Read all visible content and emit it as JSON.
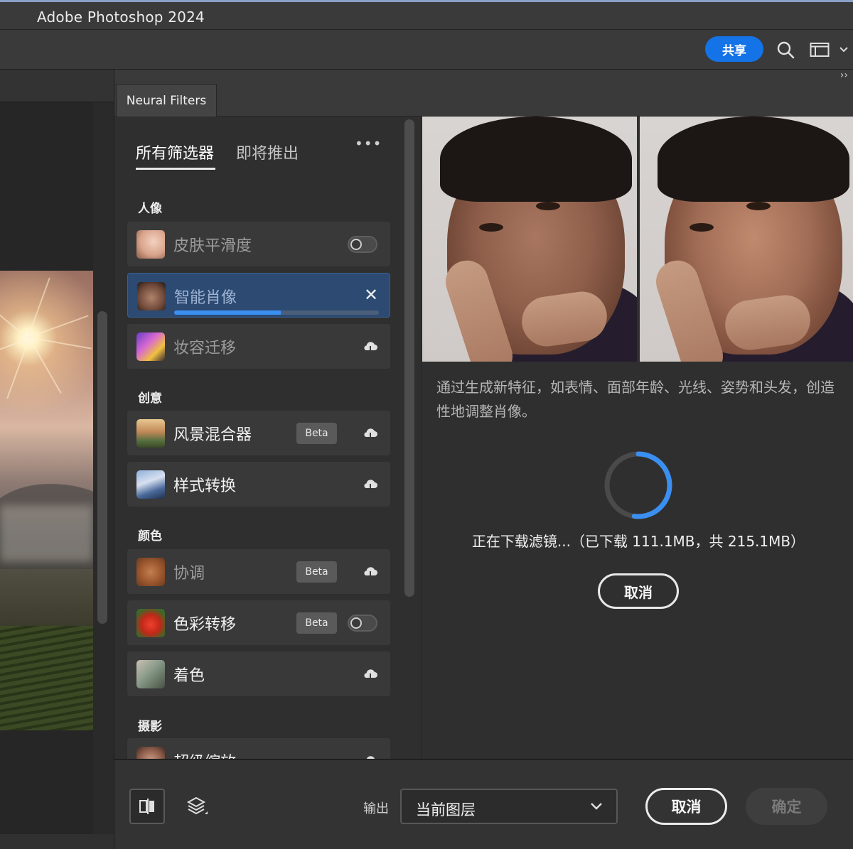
{
  "app": {
    "title": "Adobe Photoshop 2024"
  },
  "optionsbar": {
    "share_label": "共享",
    "search_icon": "search-icon",
    "workspace_icon": "workspace-icon",
    "colors": {
      "share": "#1473e6"
    }
  },
  "panel": {
    "tab_label": "Neural Filters",
    "collapse_glyph": "››"
  },
  "filter_tabs": [
    {
      "label": "所有筛选器",
      "active": true
    },
    {
      "label": "即将推出",
      "active": false
    }
  ],
  "more_glyph": "•••",
  "categories": {
    "portrait": "人像",
    "creative": "创意",
    "color": "颜色",
    "photography": "摄影"
  },
  "filters": {
    "skin": {
      "label": "皮肤平滑度",
      "state": "toggle-off"
    },
    "smart_portrait": {
      "label": "智能肖像",
      "state": "downloading",
      "progress": 0.52
    },
    "makeup": {
      "label": "妆容迁移",
      "state": "cloud"
    },
    "landscape": {
      "label": "风景混合器",
      "badge": "Beta",
      "state": "cloud"
    },
    "style": {
      "label": "样式转换",
      "state": "cloud"
    },
    "harmonize": {
      "label": "协调",
      "badge": "Beta",
      "state": "cloud"
    },
    "color_transfer": {
      "label": "色彩转移",
      "badge": "Beta",
      "state": "toggle-off"
    },
    "colorize": {
      "label": "着色",
      "state": "cloud"
    },
    "super_zoom": {
      "label": "超级缩放",
      "state": "cloud"
    }
  },
  "preview": {
    "description": "通过生成新特征，如表情、面部年龄、光线、姿势和头发，创造性地调整肖像。",
    "status": "正在下载滤镜...（已下载 111.1MB，共 215.1MB）",
    "download_fraction": 0.52,
    "cancel_label": "取消"
  },
  "footer": {
    "output_label": "输出",
    "output_value": "当前图层",
    "cancel_label": "取消",
    "ok_label": "确定"
  }
}
